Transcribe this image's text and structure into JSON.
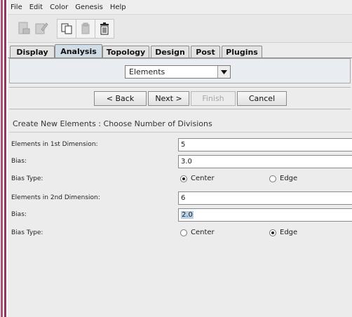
{
  "menu": [
    "File",
    "Edit",
    "Color",
    "Genesis",
    "Help"
  ],
  "toolbar": {
    "buttons": [
      {
        "icon": "new-document-icon",
        "enabled": false
      },
      {
        "icon": "edit-document-icon",
        "enabled": false
      },
      {
        "icon": "copy-icon",
        "enabled": true
      },
      {
        "icon": "paste-icon",
        "enabled": false
      },
      {
        "icon": "trash-icon",
        "enabled": true
      }
    ]
  },
  "tabs": [
    {
      "label": "Display",
      "active": false
    },
    {
      "label": "Analysis",
      "active": true
    },
    {
      "label": "Topology",
      "active": false
    },
    {
      "label": "Design",
      "active": false
    },
    {
      "label": "Post",
      "active": false
    },
    {
      "label": "Plugins",
      "active": false
    }
  ],
  "selector": {
    "value": "Elements"
  },
  "wizard": {
    "back": "< Back",
    "next": "Next >",
    "finish": "Finish",
    "cancel": "Cancel"
  },
  "form": {
    "title": "Create New Elements : Choose Number of Divisions",
    "rows": [
      {
        "label": "Elements in 1st Dimension:",
        "value": "5"
      },
      {
        "label": "Bias:",
        "value": "3.0"
      },
      {
        "label": "Bias Type:",
        "options": [
          "Center",
          "Edge"
        ],
        "selected": "Center"
      },
      {
        "label": "Elements in 2nd Dimension:",
        "value": "6"
      },
      {
        "label": "Bias:",
        "value": "2.0"
      },
      {
        "label": "Bias Type:",
        "options": [
          "Center",
          "Edge"
        ],
        "selected": "Edge"
      }
    ]
  },
  "colors": {
    "frame_accent": "#b04a76",
    "active_tab": "#d0dce6",
    "selection": "#b8cfe5"
  }
}
